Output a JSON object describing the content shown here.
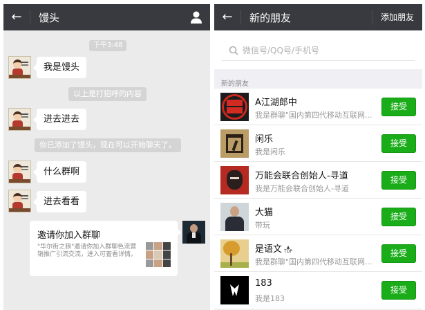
{
  "chat": {
    "header": {
      "title": "馒头",
      "back_icon": "arrow-left-icon",
      "profile_icon": "person-icon"
    },
    "time": "下午3:48",
    "messages": [
      {
        "type": "text",
        "from": "other",
        "text": "我是馒头"
      },
      {
        "type": "system",
        "text": "以上是打招呼的内容"
      },
      {
        "type": "text",
        "from": "other",
        "text": "进去进去"
      },
      {
        "type": "system",
        "text": "你已添加了馒头，现在可以开始聊天了。"
      },
      {
        "type": "text",
        "from": "other",
        "text": "什么群啊"
      },
      {
        "type": "text",
        "from": "other",
        "text": "进去看看"
      },
      {
        "type": "card",
        "from": "self",
        "title": "邀请你加入群聊",
        "description": "\"华尔街之狼\"邀请你加入群聊色流营销推广引流交流，进入可查看详情。"
      }
    ]
  },
  "new_friends": {
    "header": {
      "title": "新的朋友",
      "action": "添加朋友",
      "back_icon": "arrow-left-icon"
    },
    "search": {
      "placeholder": "微信号/QQ号/手机号",
      "icon": "search-icon"
    },
    "section_label": "新的朋友",
    "items": [
      {
        "name": "A江湖郎中",
        "message": "我是群聊\"国内第四代移动互联网...",
        "button": "接受"
      },
      {
        "name": "闲乐",
        "message": "我是闲乐",
        "button": "接受"
      },
      {
        "name": "万能会联合创始人-寻道",
        "message": "我是万能会联合创始人-寻道",
        "button": "接受"
      },
      {
        "name": "大猫",
        "message": "带玩",
        "button": "接受"
      },
      {
        "name": "是语文",
        "message": "我是群聊\"国内第四代移动互联网...",
        "button": "接受",
        "badge": "TOP"
      },
      {
        "name": "183",
        "message": "我是183",
        "button": "接受"
      }
    ]
  },
  "colors": {
    "topbar": "#393a3f",
    "chat_background": "#ebebeb",
    "accept_green": "#1aad19"
  }
}
